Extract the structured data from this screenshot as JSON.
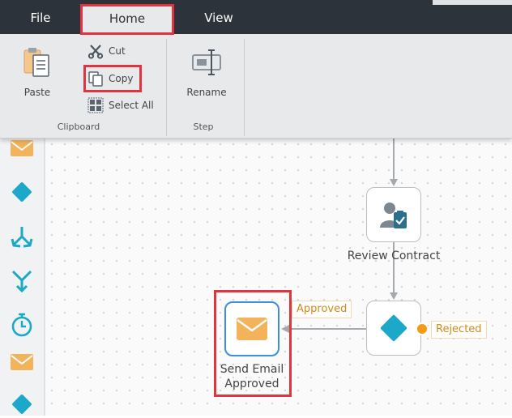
{
  "tabs": [
    {
      "label": "File"
    },
    {
      "label": "Home"
    },
    {
      "label": "View"
    }
  ],
  "ribbon": {
    "paste": "Paste",
    "cut": "Cut",
    "copy": "Copy",
    "select_all": "Select All",
    "clipboard_group": "Clipboard",
    "rename": "Rename",
    "step_group": "Step"
  },
  "palette": {
    "items": [
      "envelope-icon",
      "diamond-icon",
      "split-arrows-icon",
      "merge-arrows-icon",
      "stopwatch-icon",
      "envelope-icon",
      "diamond-icon"
    ]
  },
  "workflow": {
    "review_contract": "Review Contract",
    "send_email_line1": "Send Email",
    "send_email_line2": "Approved",
    "approved_label": "Approved",
    "rejected_label": "Rejected"
  },
  "colors": {
    "accent_teal": "#1ba8c9",
    "email_orange": "#f2b35a",
    "selection_blue": "#3d8ee0",
    "highlight_red": "#e03540",
    "rejected_dot": "#f39c12"
  }
}
